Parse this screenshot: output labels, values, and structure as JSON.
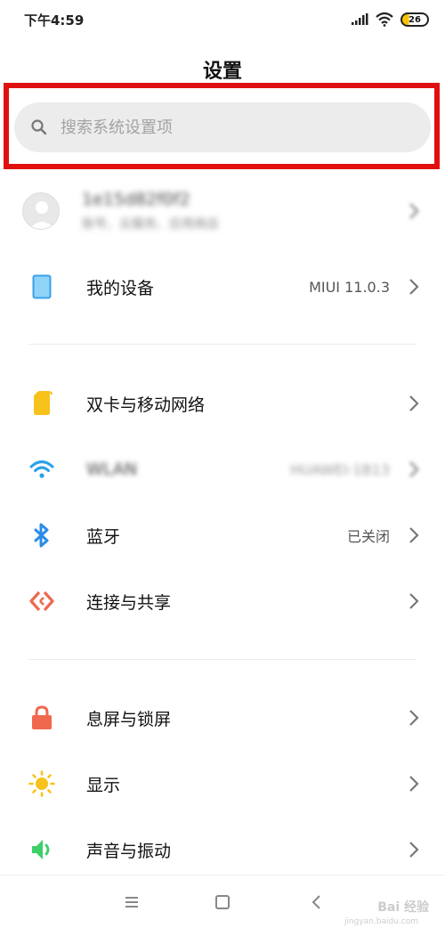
{
  "status_bar": {
    "time": "下午4:59",
    "battery": "26"
  },
  "header": {
    "title": "设置"
  },
  "search": {
    "placeholder": "搜索系统设置项"
  },
  "account": {
    "name": "1e15d82f0f2",
    "subtitle": "账号、云服务、应用商店"
  },
  "items": [
    {
      "label": "我的设备",
      "value": "MIUI 11.0.3",
      "icon": "device-icon",
      "color": "#3aa0e8"
    },
    {
      "label": "双卡与移动网络",
      "value": "",
      "icon": "sim-card-icon",
      "color": "#f7c21b"
    },
    {
      "label": "WLAN",
      "value": "HUAWEI-1B13",
      "icon": "wifi-icon",
      "color": "#2aa0e8"
    },
    {
      "label": "蓝牙",
      "value": "已关闭",
      "icon": "bluetooth-icon",
      "color": "#2a8ce8"
    },
    {
      "label": "连接与共享",
      "value": "",
      "icon": "share-icon",
      "color": "#f0684e"
    },
    {
      "label": "息屏与锁屏",
      "value": "",
      "icon": "lock-icon",
      "color": "#f0684e"
    },
    {
      "label": "显示",
      "value": "",
      "icon": "sun-icon",
      "color": "#f7c21b"
    },
    {
      "label": "声音与振动",
      "value": "",
      "icon": "speaker-icon",
      "color": "#3ccf6a"
    }
  ],
  "watermark": {
    "brand": "Bai 经验",
    "url": "jingyan.baidu.com"
  }
}
